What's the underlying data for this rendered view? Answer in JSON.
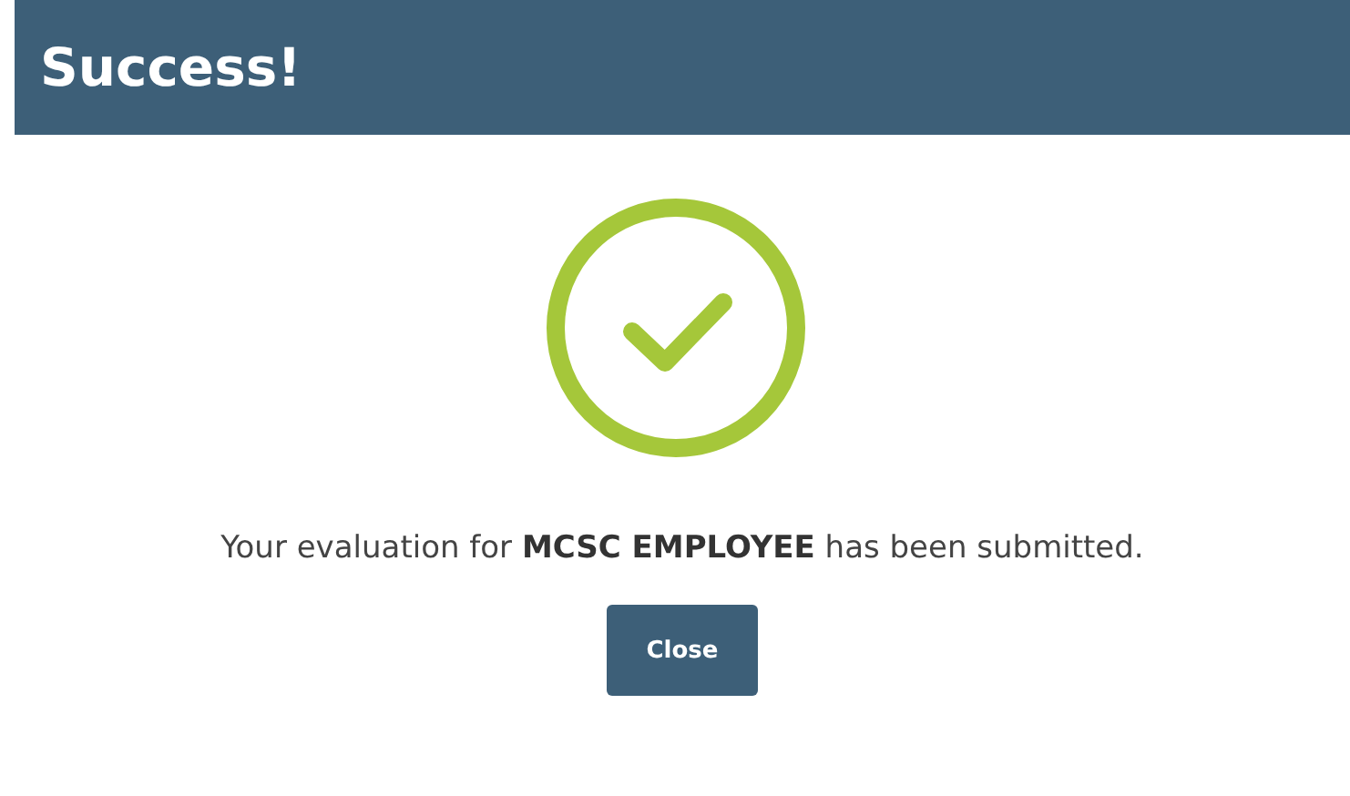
{
  "dialog": {
    "title": "Success!",
    "message": "Your evaluation for **MCSC EMPLOYEE** has been submitted.",
    "buttons": [
      {
        "label": "Close"
      }
    ]
  }
}
